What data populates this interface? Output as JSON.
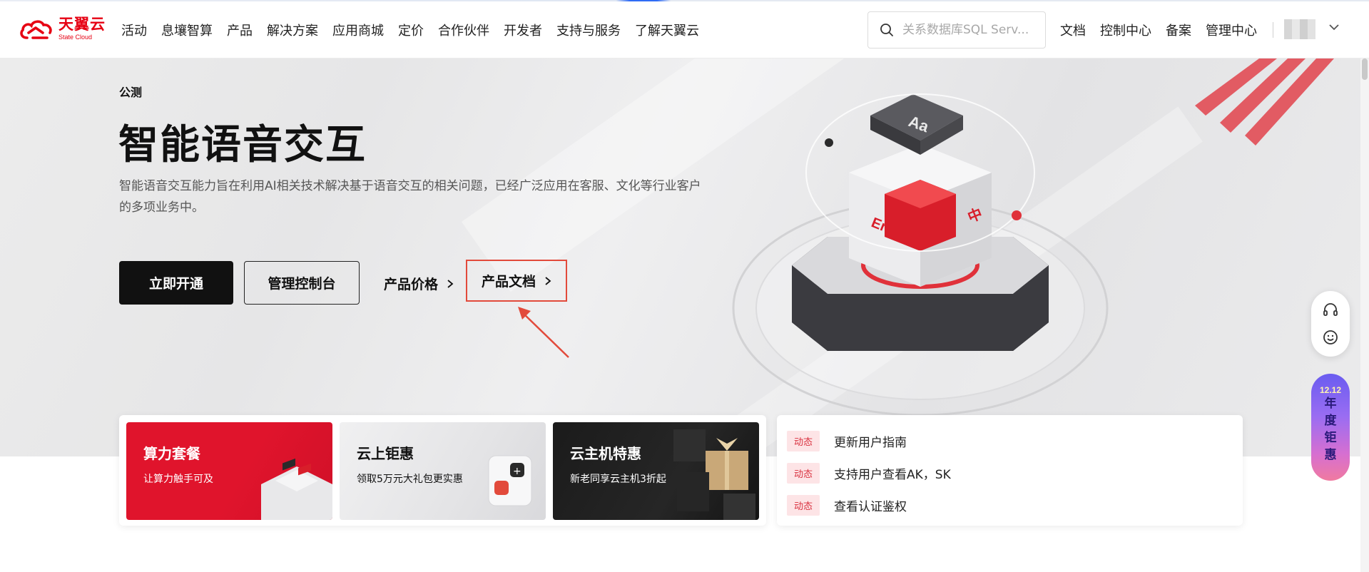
{
  "header": {
    "logo": {
      "cn": "天翼云",
      "en": "State Cloud",
      "brand_color": "#e60012"
    },
    "nav": [
      "活动",
      "息壤智算",
      "产品",
      "解决方案",
      "应用商城",
      "定价",
      "合作伙伴",
      "开发者",
      "支持与服务",
      "了解天翼云"
    ],
    "search": {
      "placeholder": "关系数据库SQL Serv..."
    },
    "util": [
      "文档",
      "控制中心",
      "备案",
      "管理中心"
    ]
  },
  "hero": {
    "badge": "公测",
    "title": "智能语音交互",
    "description": "智能语音交互能力旨在利用AI相关技术解决基于语音交互的相关问题，已经广泛应用在客服、文化等行业客户的多项业务中。",
    "primary_button": "立即开通",
    "secondary_button": "管理控制台",
    "price_link": "产品价格",
    "doc_link": "产品文档",
    "illustration_labels": {
      "top": "Aa",
      "left": "En",
      "right": "中"
    },
    "annotation_color": "#e24a3b"
  },
  "side": {
    "promo": {
      "date": "12.12",
      "chars": [
        "年",
        "度",
        "钜",
        "惠"
      ]
    }
  },
  "cards": [
    {
      "title": "算力套餐",
      "subtitle": "让算力触手可及"
    },
    {
      "title": "云上钜惠",
      "subtitle": "领取5万元大礼包更实惠"
    },
    {
      "title": "云主机特惠",
      "subtitle": "新老同享云主机3折起"
    }
  ],
  "news": [
    {
      "tag": "动态",
      "text": "更新用户指南"
    },
    {
      "tag": "动态",
      "text": "支持用户查看AK，SK"
    },
    {
      "tag": "动态",
      "text": "查看认证鉴权"
    }
  ]
}
